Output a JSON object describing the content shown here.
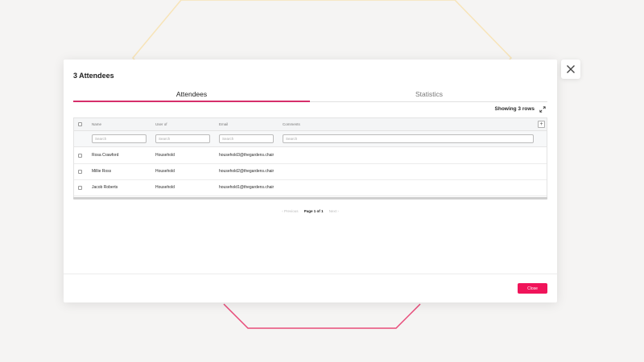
{
  "modal": {
    "title": "3 Attendees",
    "tabs": [
      {
        "label": "Attendees",
        "active": true
      },
      {
        "label": "Statistics",
        "active": false
      }
    ],
    "showing_rows": "Showing 3 rows",
    "columns": [
      "Name",
      "User of",
      "Email",
      "Comments"
    ],
    "filter_placeholder": "Search",
    "add_column_label": "+",
    "rows": [
      {
        "name": "Rosa Crawford",
        "user_of": "Household",
        "email": "household3@thegardens.chair",
        "comments": ""
      },
      {
        "name": "Millie Ross",
        "user_of": "Household",
        "email": "household2@thegardens.chair",
        "comments": ""
      },
      {
        "name": "Jacob Roberts",
        "user_of": "Household",
        "email": "household1@thegardens.chair",
        "comments": ""
      }
    ],
    "pagination": {
      "previous": "‹ Previous",
      "page": "Page 1 of 1",
      "next": "Next ›"
    },
    "close_label": "Close"
  },
  "colors": {
    "accent": "#d62e6a",
    "close_button": "#f0145a",
    "background": "#f5f4f3"
  },
  "icons": {
    "expand": "expand-diagonal-icon",
    "close": "close-x-icon"
  }
}
